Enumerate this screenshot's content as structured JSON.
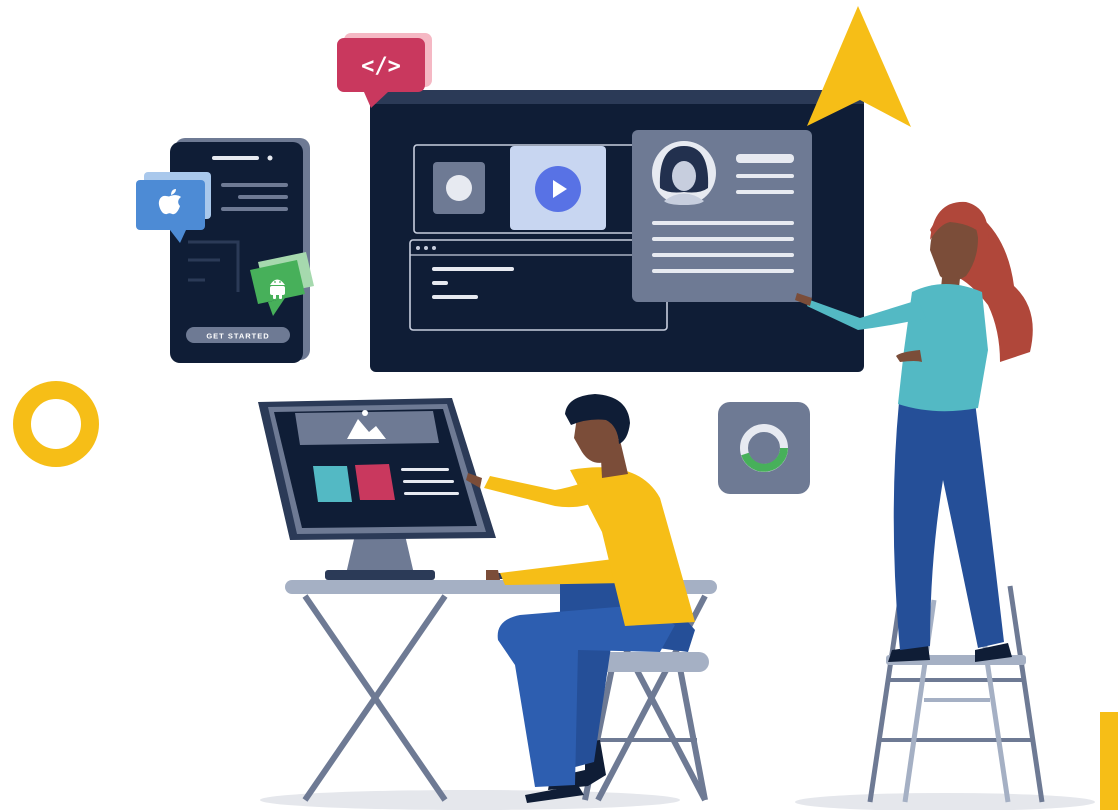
{
  "phone": {
    "button_label": "GET STARTED",
    "icons": [
      "apple-logo-icon",
      "android-logo-icon"
    ]
  },
  "code_badge": {
    "label": "</>"
  },
  "colors": {
    "navy": "#0f1d36",
    "slate": "#6e7a94",
    "yellow": "#f6be17",
    "crimson": "#c9385e",
    "teal": "#53b9c4",
    "blue": "#254f98",
    "green": "#47b05a",
    "apple_blue": "#4d8bd5",
    "video_blue": "#5872e5"
  },
  "icons": [
    "code-icon",
    "apple-logo-icon",
    "android-logo-icon",
    "play-icon",
    "avatar-icon",
    "image-icon",
    "ring-icon",
    "progress-ring-icon",
    "cursor-arrow-icon"
  ]
}
